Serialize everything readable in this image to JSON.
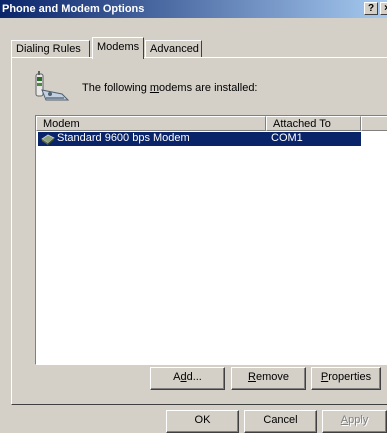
{
  "window": {
    "title": "Phone and Modem Options",
    "help_label": "?",
    "close_label": "×"
  },
  "tabs": [
    {
      "label": "Dialing Rules"
    },
    {
      "label": "Modems"
    },
    {
      "label": "Advanced"
    }
  ],
  "info": {
    "text_before": "The following ",
    "text_accel": "m",
    "text_after": "odems are  installed:",
    "icon": "phone-modem-icon"
  },
  "list": {
    "columns": [
      "Modem",
      "Attached To"
    ],
    "rows": [
      {
        "modem": "Standard  9600 bps Modem",
        "port": "COM1",
        "selected": true,
        "icon": "modem-icon"
      }
    ]
  },
  "buttons": {
    "add": {
      "pre": "A",
      "accel": "d",
      "post": "d..."
    },
    "remove": {
      "pre": "",
      "accel": "R",
      "post": "emove"
    },
    "properties": {
      "pre": "",
      "accel": "P",
      "post": "roperties"
    }
  },
  "dialog_buttons": {
    "ok": "OK",
    "cancel": "Cancel",
    "apply": {
      "pre": "",
      "accel": "A",
      "post": "pply"
    }
  },
  "colors": {
    "face": "#d4d0c8",
    "selection": "#0a246a",
    "title_start": "#0a246a",
    "title_end": "#a6caf0"
  }
}
